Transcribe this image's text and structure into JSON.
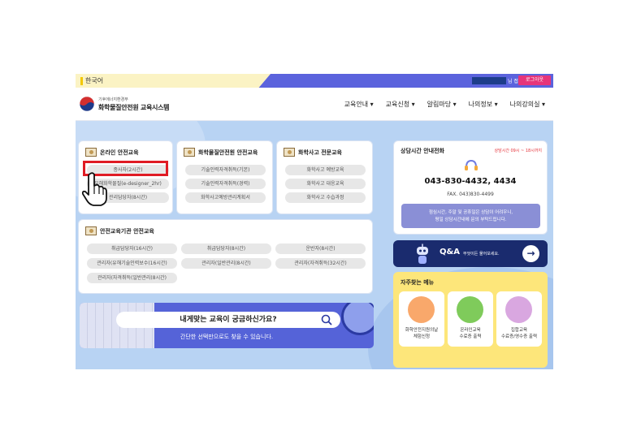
{
  "topbar": {
    "language": "한국어",
    "user_suffix": "님 접속중",
    "logout": "로그아웃"
  },
  "header": {
    "org": "기후에너지환경부",
    "system_name": "화학물질안전원 교육시스템",
    "nav": [
      "교육안내 ▾",
      "교육신청 ▾",
      "알림마당 ▾",
      "나의정보 ▾",
      "나의강의실 ▾"
    ]
  },
  "online": {
    "title": "온라인 안전교육",
    "items": [
      "종사자(2시간)",
      "유해화학물질(e-designer_2hr)",
      "관리담당자(8시간)"
    ]
  },
  "institute": {
    "title": "화학물질안전원 안전교육",
    "items": [
      "기술인력자격취득(기본)",
      "기술인력자격취득(경력)",
      "화학사고예방관리계획서"
    ]
  },
  "expert": {
    "title": "화학사고 전문교육",
    "items": [
      "화학사고 예방교육",
      "화학사고 대응교육",
      "화학사고 수습과정"
    ]
  },
  "agency": {
    "title": "안전교육기관 안전교육",
    "items": [
      "취급담당자(16시간)",
      "취급담당자(8시간)",
      "운반자(8시간)",
      "관리자(유해기술인력보수(16시간)",
      "관리자(일반관리(8시간)",
      "관리자(자격취득(32시간)",
      "관리자(자격취득(일반관리(8시간)"
    ]
  },
  "consult": {
    "title": "상담시간 안내전화",
    "hours": "상담시간 09시 ~ 18시까지",
    "phone": "043-830-4432, 4434",
    "fax": "FAX. 043)830-4499",
    "note_line1": "점심시간, 주말 및 공휴일은 상담이 어려우니,",
    "note_line2": "평일 상담시간내에 문의 부탁드립니다."
  },
  "qna": {
    "label": "Q&A",
    "sub": "무엇이든 물어보세요.",
    "arrow": "→"
  },
  "quick": {
    "title": "자주찾는 메뉴",
    "items": [
      {
        "line1": "화학안전지원의날",
        "line2": "체험신청",
        "color": "#f9a86b"
      },
      {
        "line1": "온라인교육",
        "line2": "수료증 출력",
        "color": "#7fcb5b"
      },
      {
        "line1": "집합교육",
        "line2": "수료증/영수증 출력",
        "color": "#d9a7e0"
      }
    ]
  },
  "banner": {
    "question": "내게맞는 교육이 궁금하신가요?",
    "sub": "간단한 선택만으로도 찾을 수 있습니다."
  },
  "colors": {
    "accent": "#5b63dd",
    "highlight": "#e01b24",
    "logout": "#e6357a"
  }
}
